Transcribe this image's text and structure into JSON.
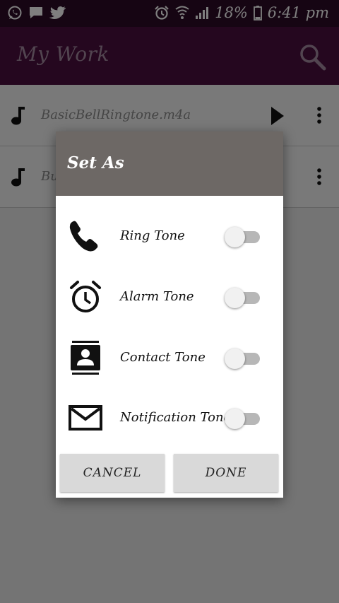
{
  "status_bar": {
    "battery": "18%",
    "time": "6:41 pm",
    "left_icons": [
      "whatsapp-icon",
      "message-icon",
      "twitter-icon"
    ],
    "right_icons": [
      "alarm-icon",
      "wifi-icon",
      "signal-icon",
      "battery-icon"
    ]
  },
  "app_bar": {
    "title": "My Work",
    "search_icon": "search-icon"
  },
  "list": {
    "items": [
      {
        "name": "BasicBellRingtone.m4a"
      },
      {
        "name": "Bu"
      }
    ]
  },
  "dialog": {
    "title": "Set As",
    "options": [
      {
        "label": "Ring Tone",
        "icon": "phone-icon",
        "enabled": false
      },
      {
        "label": "Alarm Tone",
        "icon": "alarm-clock-icon",
        "enabled": false
      },
      {
        "label": "Contact Tone",
        "icon": "contact-icon",
        "enabled": false
      },
      {
        "label": "Notification Tone",
        "icon": "mail-icon",
        "enabled": false
      }
    ],
    "cancel_label": "CANCEL",
    "done_label": "DONE"
  },
  "colors": {
    "status_bar": "#2d0a27",
    "app_bar": "#4a0f3f",
    "dialog_header": "#6d6865",
    "button": "#d9d9d9"
  }
}
